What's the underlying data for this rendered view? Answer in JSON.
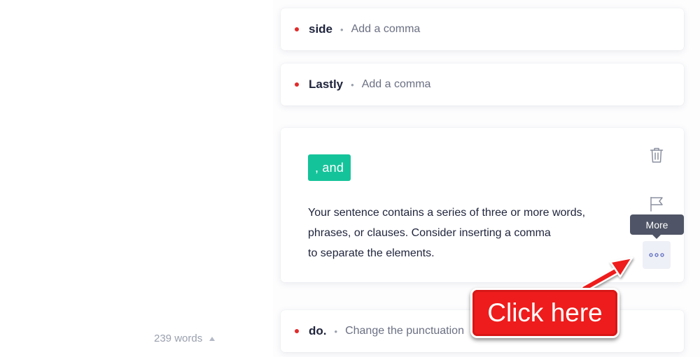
{
  "cards": [
    {
      "keyword": "side",
      "description": "Add a comma"
    },
    {
      "keyword": "Lastly",
      "description": "Add a comma"
    },
    {
      "keyword": "do.",
      "description": "Change the punctuation"
    }
  ],
  "expanded_card": {
    "suggestion": ", and",
    "explanation_lines": [
      "Your sentence contains a series of three or more words,",
      "phrases, or clauses. Consider inserting a comma",
      "to separate the elements."
    ],
    "icons": {
      "delete": "trash-icon",
      "flag": "flag-icon",
      "more": "more-dots-icon"
    }
  },
  "tooltip": {
    "label": "More"
  },
  "annotation": {
    "label": "Click here"
  },
  "footer": {
    "word_count": "239 words"
  },
  "colors": {
    "accent_green": "#15c39a",
    "error_red": "#e22b2b",
    "annotation_red": "#ee1c1c",
    "tooltip_bg": "#4f5566"
  }
}
